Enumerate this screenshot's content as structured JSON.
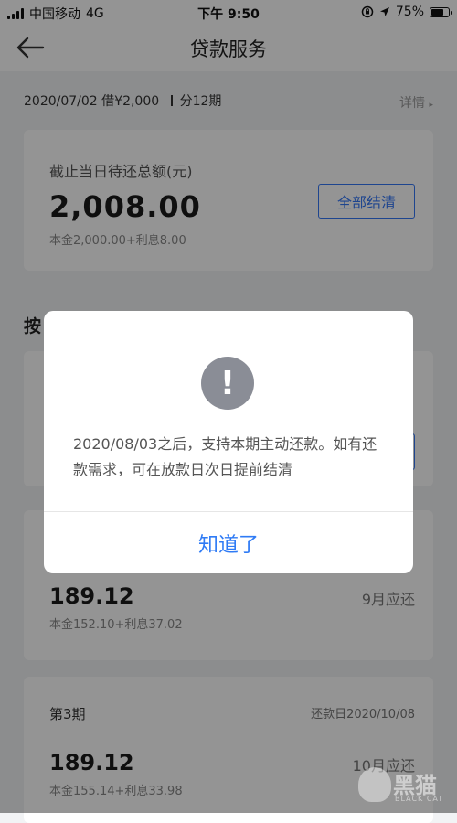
{
  "status_bar": {
    "carrier": "中国移动",
    "network": "4G",
    "time": "下午 9:50",
    "battery_percent": "75%",
    "battery_level": 0.75
  },
  "nav": {
    "title": "贷款服务"
  },
  "loan": {
    "date": "2020/07/02",
    "amount": "借¥2,000",
    "terms": "分12期",
    "detail_link": "详情"
  },
  "total_card": {
    "label": "截止当日待还总额(元)",
    "amount": "2,008.00",
    "breakdown": "本金2,000.00+利息8.00",
    "settle_button": "全部结清"
  },
  "section_title": "按",
  "periods": [
    {
      "title": "",
      "due_date": "",
      "amount": "",
      "breakdown": "",
      "month_label": ""
    },
    {
      "title": "",
      "due_date": "",
      "amount": "189.12",
      "breakdown": "本金152.10+利息37.02",
      "month_label": "9月应还"
    },
    {
      "title": "第3期",
      "due_date": "还款日2020/10/08",
      "amount": "189.12",
      "breakdown": "本金155.14+利息33.98",
      "month_label": "10月应还"
    }
  ],
  "dialog": {
    "icon": "exclamation-icon",
    "message": "2020/08/03之后，支持本期主动还款。如有还款需求，可在放款日次日提前结清",
    "confirm_button": "知道了"
  },
  "watermark": {
    "text": "黑猫",
    "subtext": "BLACK CAT"
  },
  "colors": {
    "accent": "#2f7bf5",
    "overlay": "rgba(0,0,0,0.42)",
    "icon_gray": "#8a8d96"
  }
}
